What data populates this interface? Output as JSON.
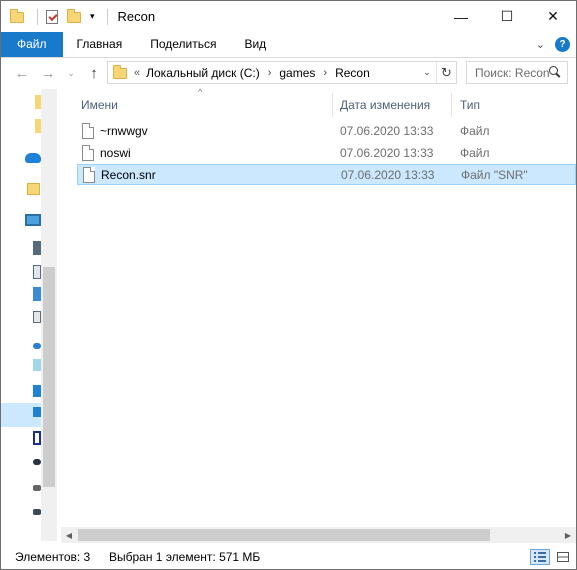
{
  "window": {
    "title": "Recon",
    "controls": {
      "minimize": "—",
      "maximize": "☐",
      "close": "✕"
    },
    "qat": {
      "dropdown_glyph": "▾",
      "folder_icon": "folder-icon",
      "properties_icon": "properties-icon"
    }
  },
  "ribbon": {
    "tabs": [
      "Файл",
      "Главная",
      "Поделиться",
      "Вид"
    ],
    "expand_glyph": "⌄",
    "help_glyph": "?",
    "accent_color": "#1979ca"
  },
  "nav": {
    "back_glyph": "←",
    "forward_glyph": "→",
    "recent_glyph": "⌄",
    "up_glyph": "↑"
  },
  "address": {
    "overflow": "«",
    "crumbs": [
      "Локальный диск (C:)",
      "games",
      "Recon"
    ],
    "separator": "›",
    "dropdown_glyph": "⌄",
    "refresh_glyph": "↻"
  },
  "search": {
    "placeholder": "Поиск: Recon"
  },
  "columns": {
    "name": "Имени",
    "date": "Дата изменения",
    "type": "Тип",
    "sort_glyph": "^"
  },
  "files": [
    {
      "name": "~rnwwgv",
      "date": "07.06.2020 13:33",
      "type": "Файл",
      "selected": false
    },
    {
      "name": "noswi",
      "date": "07.06.2020 13:33",
      "type": "Файл",
      "selected": false
    },
    {
      "name": "Recon.snr",
      "date": "07.06.2020 13:33",
      "type": "Файл \"SNR\"",
      "selected": true
    }
  ],
  "status": {
    "count": "Элементов: 3",
    "selection": "Выбран 1 элемент: 571 МБ"
  },
  "colors": {
    "selection_bg": "#cce8ff",
    "selection_border": "#99d1ff",
    "header_text": "#4c607a",
    "muted_text": "#6d6d6d"
  }
}
